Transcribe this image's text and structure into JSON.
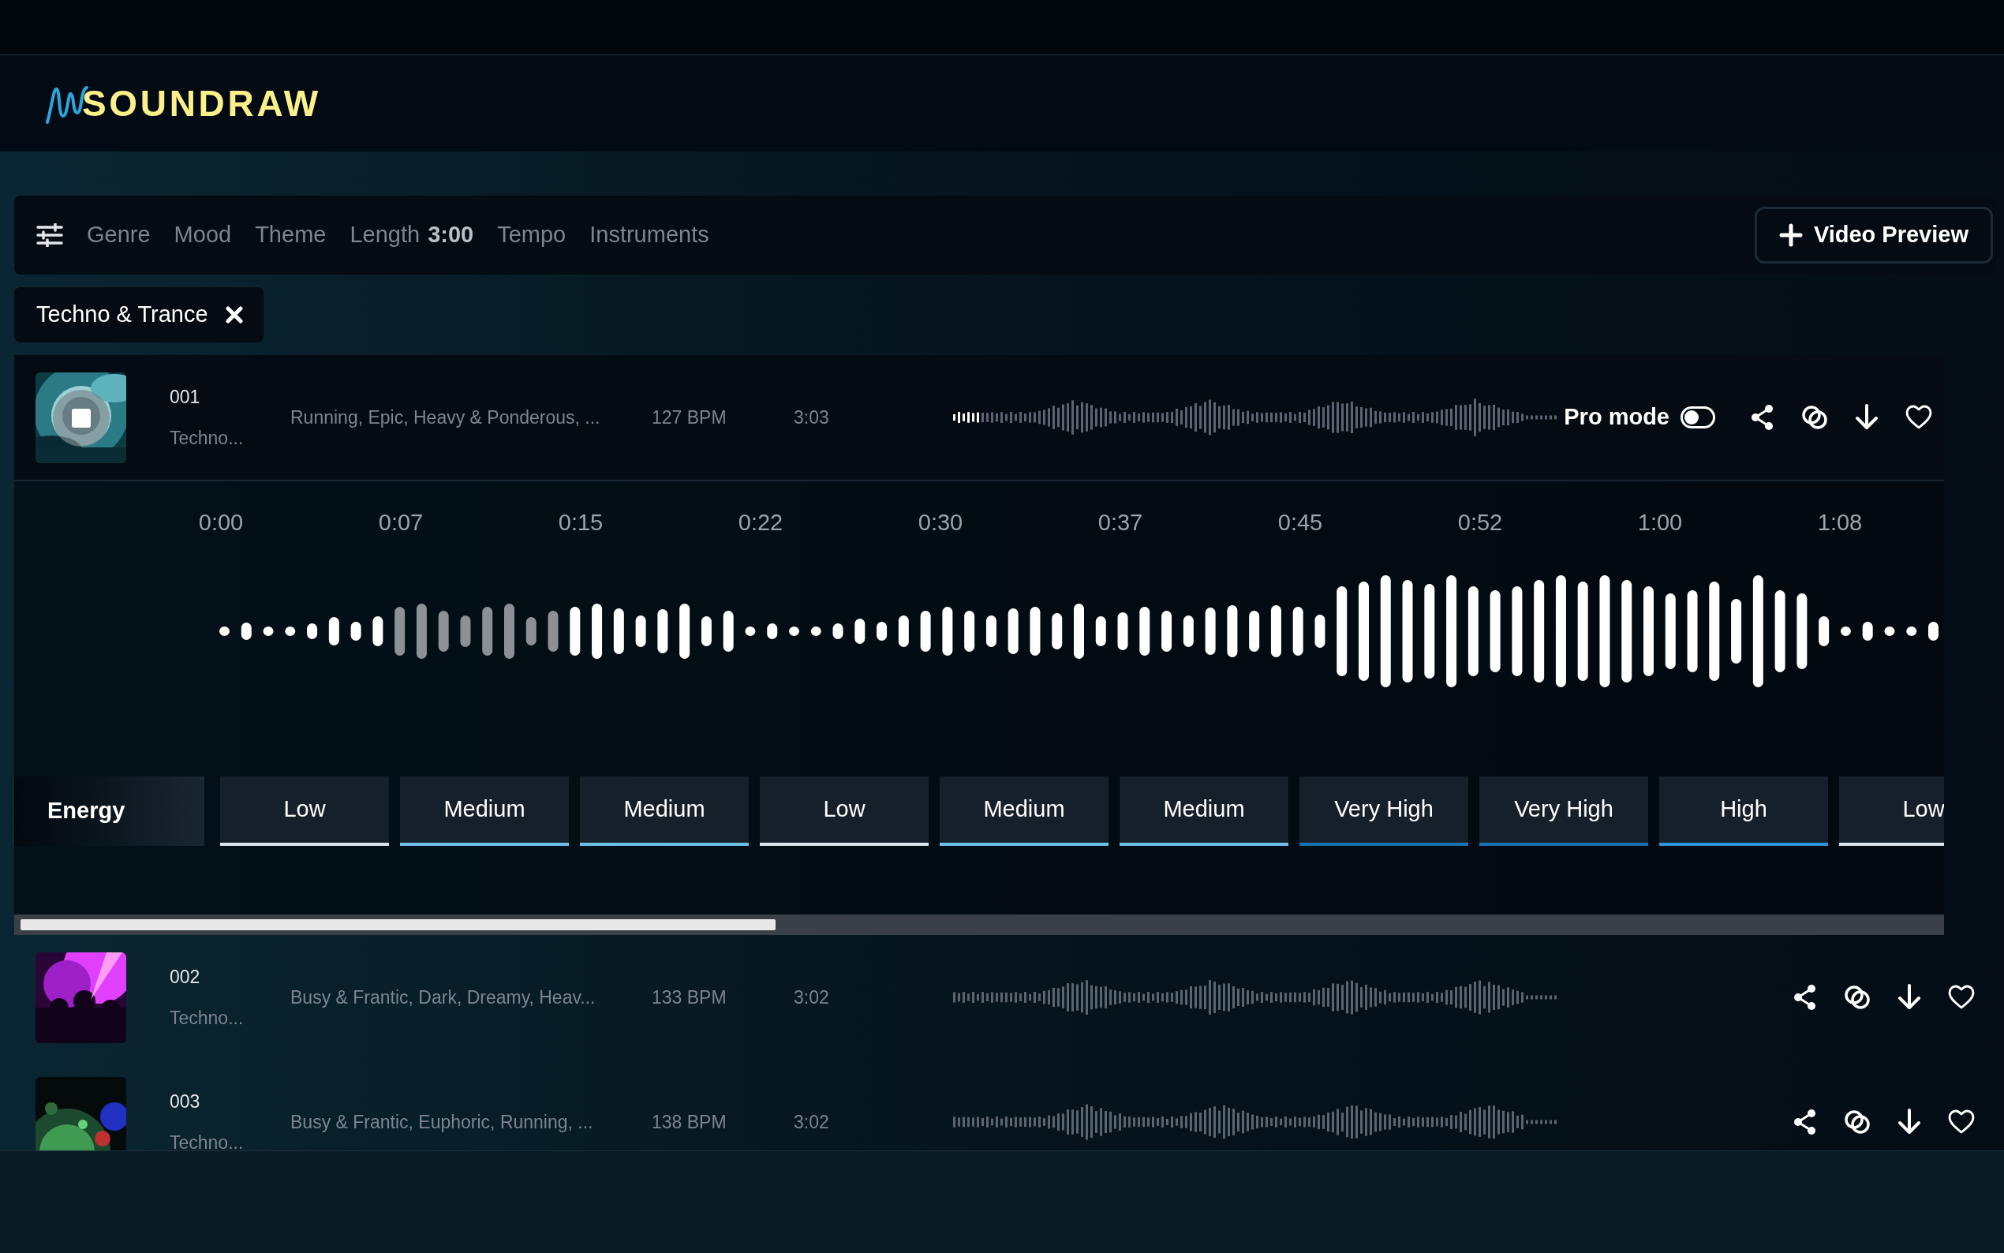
{
  "logo": "SOUNDRAW",
  "filters": [
    {
      "label": "Genre"
    },
    {
      "label": "Mood"
    },
    {
      "label": "Theme"
    },
    {
      "label": "Length",
      "value": "3:00"
    },
    {
      "label": "Tempo"
    },
    {
      "label": "Instruments"
    }
  ],
  "video_preview_button": "Video Preview",
  "active_filters": [
    {
      "label": "Techno & Trance"
    }
  ],
  "tracks": [
    {
      "number": "001",
      "genre": "Techno...",
      "tags": "Running, Epic, Heavy & Ponderous, ...",
      "bpm": "127 BPM",
      "duration": "3:03",
      "playing": true,
      "expanded": true,
      "pro_mode": {
        "label": "Pro mode",
        "on": false
      }
    },
    {
      "number": "002",
      "genre": "Techno...",
      "tags": "Busy & Frantic, Dark, Dreamy, Heav...",
      "bpm": "133 BPM",
      "duration": "3:02",
      "playing": false,
      "expanded": false
    },
    {
      "number": "003",
      "genre": "Techno...",
      "tags": "Busy & Frantic, Euphoric, Running, ...",
      "bpm": "138 BPM",
      "duration": "3:02",
      "playing": false,
      "expanded": false
    }
  ],
  "timeline": [
    "0:00",
    "0:07",
    "0:15",
    "0:22",
    "0:30",
    "0:37",
    "0:45",
    "0:52",
    "1:00",
    "1:08"
  ],
  "energy": {
    "label": "Energy",
    "segments": [
      {
        "label": "Low",
        "color": "#dbe4ea"
      },
      {
        "label": "Medium",
        "color": "#6cc0e8"
      },
      {
        "label": "Medium",
        "color": "#6cc0e8"
      },
      {
        "label": "Low",
        "color": "#dbe4ea"
      },
      {
        "label": "Medium",
        "color": "#6cc0e8"
      },
      {
        "label": "Medium",
        "color": "#6cc0e8"
      },
      {
        "label": "Very High",
        "color": "#1672b0"
      },
      {
        "label": "Very High",
        "color": "#1672b0"
      },
      {
        "label": "High",
        "color": "#2b96d6"
      },
      {
        "label": "Low",
        "color": "#dbe4ea"
      }
    ]
  }
}
